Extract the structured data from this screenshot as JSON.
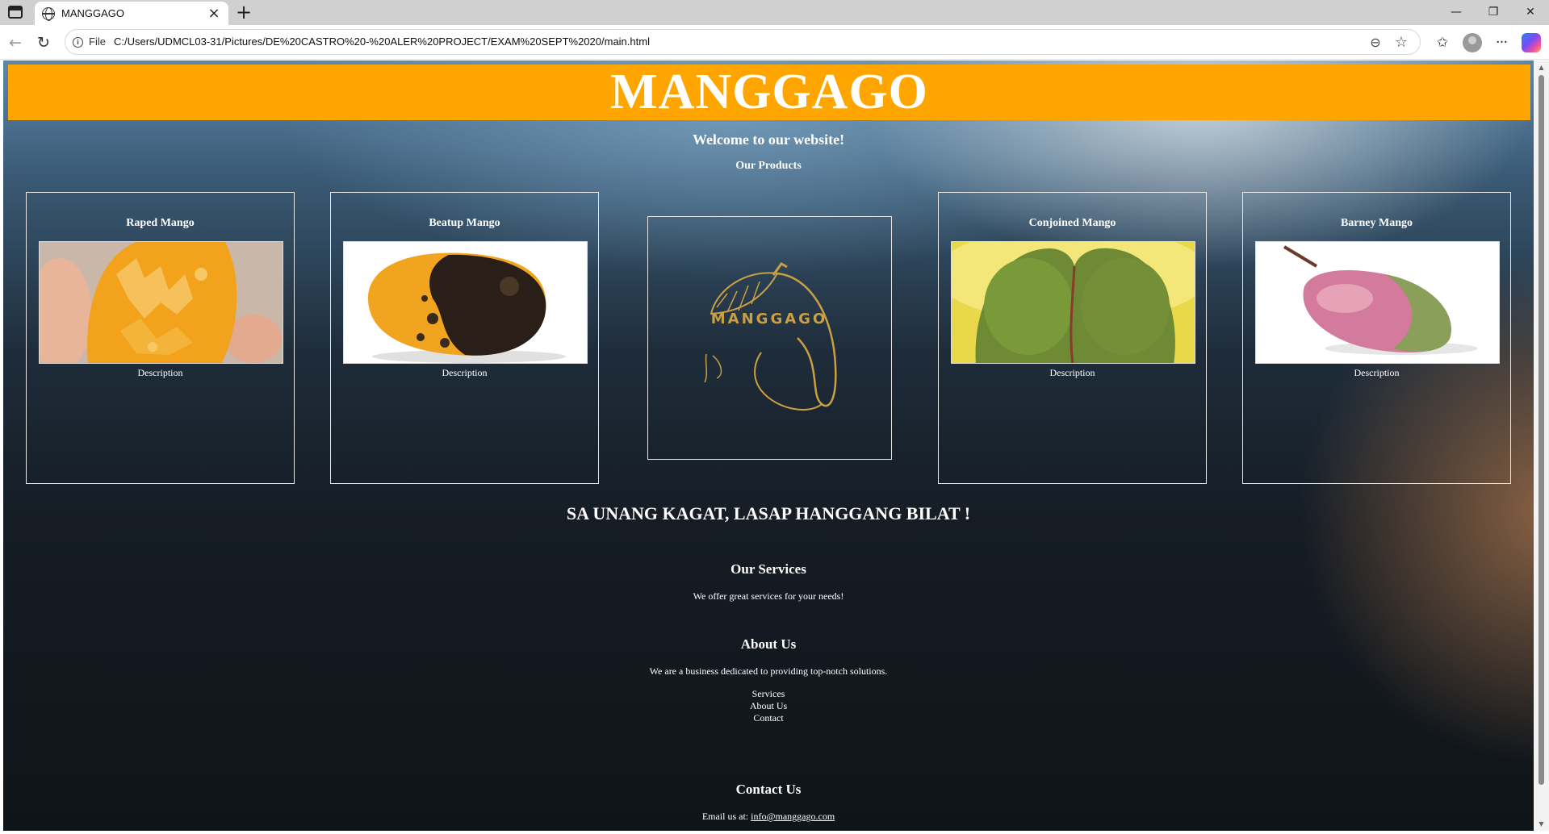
{
  "browser": {
    "tab_title": "MANGGAGO",
    "file_label": "File",
    "url": "C:/Users/UDMCL03-31/Pictures/DE%20CASTRO%20-%20ALER%20PROJECT/EXAM%20SEPT%2020/main.html"
  },
  "site": {
    "title": "MANGGAGO",
    "welcome": "Welcome to our website!",
    "products_heading": "Our Products",
    "products": [
      {
        "name": "Raped Mango",
        "description": "Description"
      },
      {
        "name": "Beatup Mango",
        "description": "Description"
      },
      {
        "name": "Conjoined Mango",
        "description": "Description"
      },
      {
        "name": "Barney Mango",
        "description": "Description"
      }
    ],
    "logo_text": "MANGGAGO",
    "tagline": "SA UNANG KAGAT, LASAP HANGGANG BILAT !",
    "services": {
      "title": "Our Services",
      "text": "We offer great services for your needs!"
    },
    "about": {
      "title": "About Us",
      "text": "We are a business dedicated to providing top-notch solutions."
    },
    "footer_links": [
      "Services",
      "About Us",
      "Contact"
    ],
    "contact": {
      "title": "Contact Us",
      "email_prefix": "Email us at:",
      "email": "info@manggago.com"
    }
  },
  "colors": {
    "header_orange": "#ffa500",
    "logo_gold": "#c9a044"
  }
}
